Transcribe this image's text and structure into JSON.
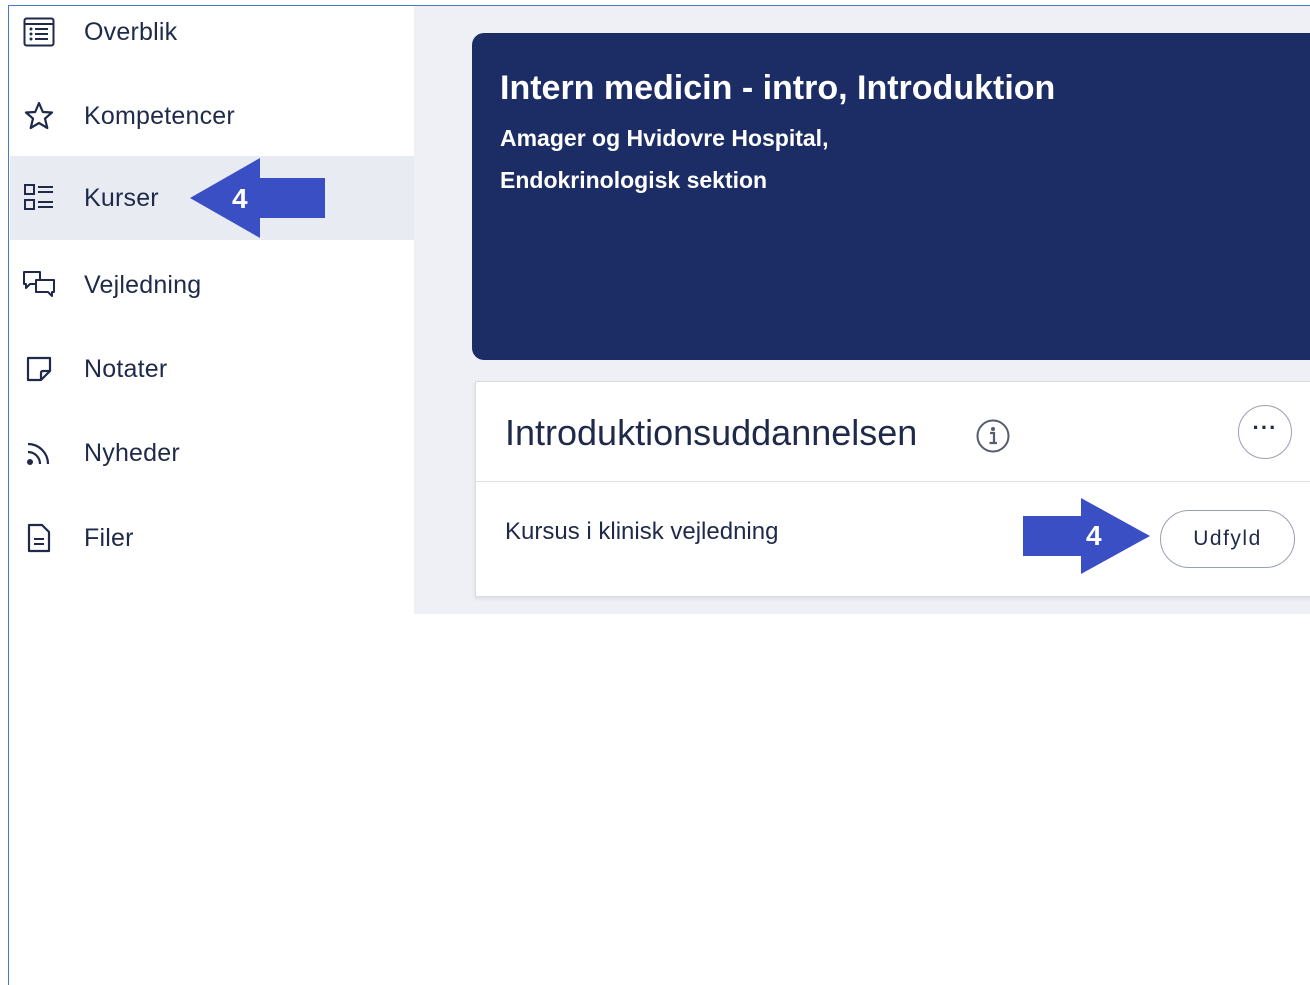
{
  "sidebar": {
    "items": [
      {
        "label": "Overblik",
        "icon": "list-view-icon"
      },
      {
        "label": "Kompetencer",
        "icon": "star-icon"
      },
      {
        "label": "Kurser",
        "icon": "checklist-icon",
        "active": true
      },
      {
        "label": "Vejledning",
        "icon": "chat-bubbles-icon"
      },
      {
        "label": "Notater",
        "icon": "note-icon"
      },
      {
        "label": "Nyheder",
        "icon": "rss-icon"
      },
      {
        "label": "Filer",
        "icon": "file-icon"
      }
    ]
  },
  "hero": {
    "title": "Intern medicin - intro, Introduktion",
    "hospital": "Amager og Hvidovre Hospital,",
    "department": "Endokrinologisk sektion"
  },
  "course_card": {
    "title": "Introduktionsuddannelsen",
    "more_label": "···",
    "row_label": "Kursus i klinisk vejledning",
    "fill_button": "Udfyld"
  },
  "callouts": {
    "sidebar_step": "4",
    "button_step": "4",
    "color": "#3b4fc4"
  },
  "colors": {
    "hero_bg": "#1c2d66",
    "active_bg": "#e9ebf2",
    "main_bg": "#eef0f5"
  }
}
